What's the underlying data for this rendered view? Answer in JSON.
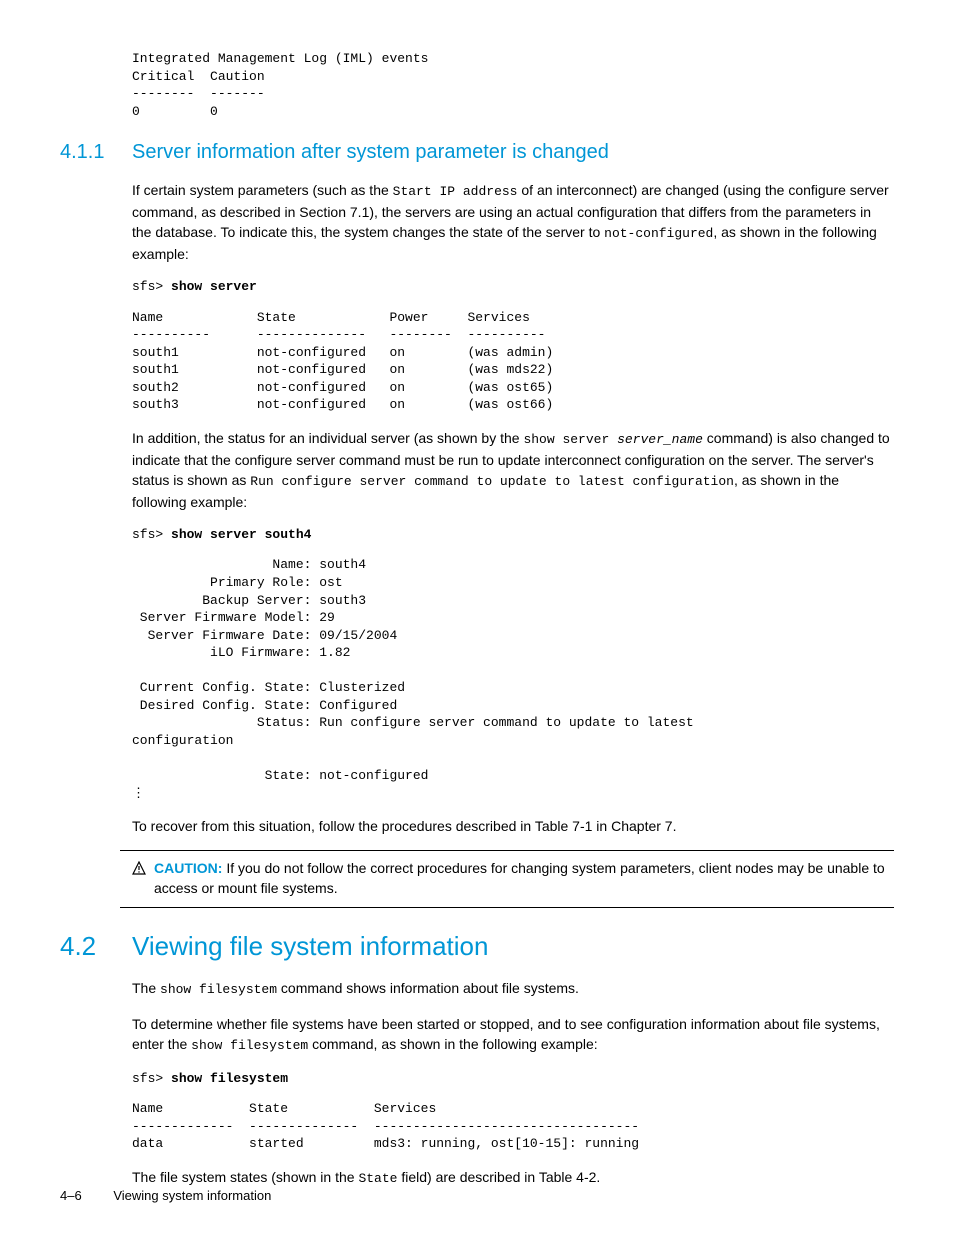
{
  "topBlock": "Integrated Management Log (IML) events\nCritical  Caution\n--------  -------\n0         0",
  "sec411": {
    "num": "4.1.1",
    "title": "Server information after system parameter is changed",
    "para1_a": "If certain system parameters (such as the ",
    "para1_code1": "Start IP address",
    "para1_b": " of an interconnect) are changed (using the configure server command, as described in Section 7.1), the servers are using an actual configuration that differs from the parameters in the database. To indicate this, the system changes the state of the server to ",
    "para1_code2": "not-configured",
    "para1_c": ", as shown in the following example:",
    "cmd1_prompt": "sfs> ",
    "cmd1_cmd": "show server",
    "table1": "Name            State            Power     Services\n----------      --------------   --------  ----------\nsouth1          not-configured   on        (was admin)\nsouth1          not-configured   on        (was mds22)\nsouth2          not-configured   on        (was ost65)\nsouth3          not-configured   on        (was ost66)",
    "para2_a": "In addition, the status for an individual server (as shown by the ",
    "para2_code1": "show server ",
    "para2_code1_italic": "server_name",
    "para2_b": " command) is also changed to indicate that the configure server command must be run to update interconnect configuration on the server. The server's status is shown as ",
    "para2_code2": "Run configure server command to update to latest configuration",
    "para2_c": ", as shown in the following example:",
    "cmd2_prompt": "sfs> ",
    "cmd2_cmd": "show server south4",
    "block2": "                  Name: south4\n          Primary Role: ost\n         Backup Server: south3\n Server Firmware Model: 29\n  Server Firmware Date: 09/15/2004\n          iLO Firmware: 1.82\n\n Current Config. State: Clusterized\n Desired Config. State: Configured\n                Status: Run configure server command to update to latest\nconfiguration\n\n                 State: not-configured\n⋮",
    "para3": "To recover from this situation, follow the procedures described in Table 7-1 in Chapter 7."
  },
  "caution": {
    "label": "CAUTION:",
    "text": " If you do not follow the correct procedures for changing system parameters, client nodes may be unable to access or mount file systems."
  },
  "sec42": {
    "num": "4.2",
    "title": "Viewing file system information",
    "para1_a": "The ",
    "para1_code": "show filesystem",
    "para1_b": " command shows information about file systems.",
    "para2_a": "To determine whether file systems have been started or stopped, and to see configuration information about file systems, enter the ",
    "para2_code": "show filesystem",
    "para2_b": " command, as shown in the following example:",
    "cmd_prompt": "sfs> ",
    "cmd_cmd": "show filesystem",
    "table": "Name           State           Services\n-------------  --------------  ----------------------------------\ndata           started         mds3: running, ost[10-15]: running",
    "para3_a": "The file system states (shown in the ",
    "para3_code": "State",
    "para3_b": " field) are described in Table 4-2."
  },
  "footer": {
    "page": "4–6",
    "title": "Viewing system information"
  }
}
